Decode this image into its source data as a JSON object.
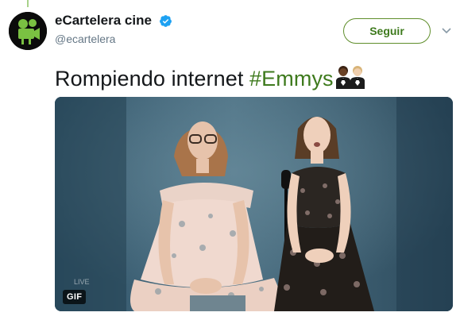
{
  "account": {
    "display_name": "eCartelera cine",
    "handle": "@ecartelera",
    "avatar_icon": "film-camera-icon",
    "verified_icon": "verified-badge-icon"
  },
  "follow_button": {
    "label": "Seguir"
  },
  "menu_icon": "chevron-down-icon",
  "tweet": {
    "text": "Rompiendo internet ",
    "hashtag": "#Emmys",
    "emoji": "men-in-tuxedo-emoji"
  },
  "media": {
    "badge": "GIF",
    "overlay_text": "LIVE"
  },
  "colors": {
    "accent": "#3e7a1d",
    "follow_border": "#5f8e2b",
    "verified": "#1da1f2",
    "avatar_bg": "#0b0b0b",
    "avatar_glyph": "#7ac142"
  }
}
